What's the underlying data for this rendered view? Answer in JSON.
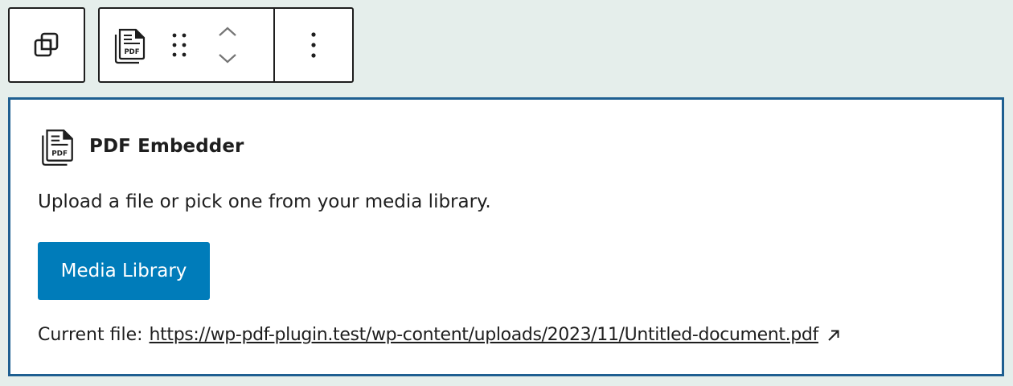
{
  "toolbar": {
    "parent_icon": "parent-block-icon",
    "block_type_icon": "pdf-document-icon",
    "drag_icon": "drag-handle-icon",
    "move_up_icon": "chevron-up-icon",
    "move_down_icon": "chevron-down-icon",
    "options_icon": "more-vertical-icon"
  },
  "block": {
    "icon": "pdf-document-icon",
    "icon_label": "PDF",
    "title": "PDF Embedder",
    "instructions": "Upload a file or pick one from your media library.",
    "media_button_label": "Media Library",
    "current_file_label": "Current file:",
    "current_file_url": "https://wp-pdf-plugin.test/wp-content/uploads/2023/11/Untitled-document.pdf",
    "external_link_icon": "external-link-icon"
  },
  "colors": {
    "background": "#e5eeeb",
    "accent": "#007cba",
    "selection_border": "#1e5f91",
    "text": "#1e1e1e"
  }
}
